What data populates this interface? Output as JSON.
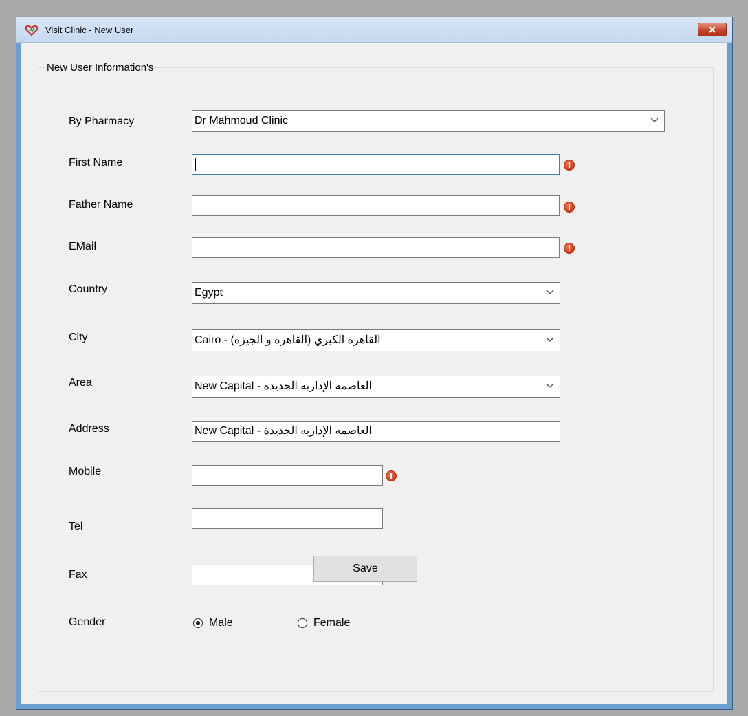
{
  "window": {
    "title": "Visit Clinic - New User",
    "close_icon": "close-x-icon"
  },
  "group": {
    "title": "New User Information's"
  },
  "labels": {
    "by_pharmacy": "By Pharmacy",
    "first_name": "First Name",
    "father_name": "Father Name",
    "email": "EMail",
    "country": "Country",
    "city": "City",
    "area": "Area",
    "address": "Address",
    "mobile": "Mobile",
    "tel": "Tel",
    "fax": "Fax",
    "gender": "Gender"
  },
  "fields": {
    "by_pharmacy": "Dr Mahmoud Clinic",
    "first_name": "",
    "father_name": "",
    "email": "",
    "country": "Egypt",
    "city": "القاهرة الكبري (القاهرة و الجيزة) - Cairo",
    "area": "العاصمه الإداريه الجديدة - New Capital",
    "address": "العاصمه الإداريه الجديدة - New Capital",
    "mobile": "",
    "tel": "",
    "fax": ""
  },
  "validation_icon": "!",
  "gender": {
    "options": [
      "Male",
      "Female"
    ],
    "selected": "Male"
  },
  "save_label": "Save",
  "colors": {
    "error": "#d03c17",
    "focus_border": "#3c7fb1",
    "close_button": "#c4442d"
  }
}
